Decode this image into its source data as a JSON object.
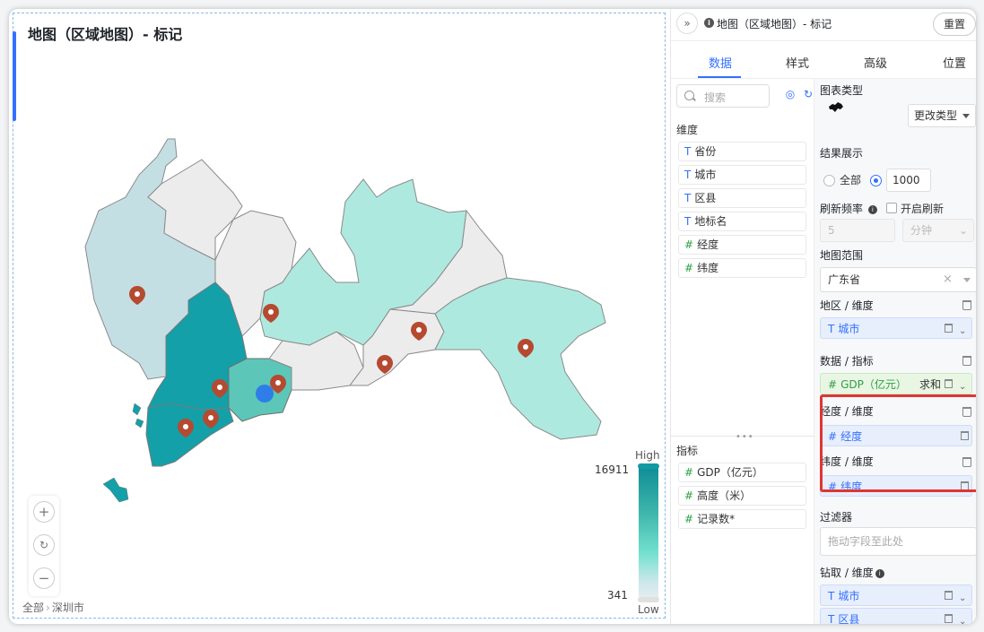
{
  "map": {
    "title": "地图（区域地图）- 标记",
    "legend_high": "High",
    "legend_low": "Low",
    "legend_max": "16911",
    "legend_min": "341",
    "breadcrumb": [
      "全部",
      "深圳市"
    ],
    "zoom_in": "+",
    "zoom_reset": "↻",
    "zoom_out": "−",
    "colors": {
      "dark": "#13a0a8",
      "mid": "#5cc7b9",
      "light": "#aee9df",
      "pale": "#c4dfe4",
      "gray": "#ececec",
      "marker": "#b54a31",
      "point": "#2f7ee8"
    }
  },
  "panel": {
    "title": "地图（区域地图）- 标记",
    "reset": "重置",
    "collapse": "»",
    "info": "i",
    "tabs": [
      "数据",
      "样式",
      "高级",
      "位置"
    ],
    "active_tab": 0,
    "search_placeholder": "搜索",
    "dimension_label": "维度",
    "dimensions": [
      {
        "type": "T",
        "name": "省份"
      },
      {
        "type": "T",
        "name": "城市"
      },
      {
        "type": "T",
        "name": "区县"
      },
      {
        "type": "T",
        "name": "地标名"
      },
      {
        "type": "#",
        "name": "经度"
      },
      {
        "type": "#",
        "name": "纬度"
      }
    ],
    "measure_label": "指标",
    "measures": [
      {
        "type": "#",
        "name": "GDP（亿元）"
      },
      {
        "type": "#",
        "name": "高度（米）"
      },
      {
        "type": "#",
        "name": "记录数*"
      }
    ],
    "splitter": "•••",
    "chart_type_label": "图表类型",
    "change_type": "更改类型",
    "result_label": "结果展示",
    "result_all": "全部",
    "result_count": "1000",
    "refresh_label": "刷新频率",
    "refresh_enable": "开启刷新",
    "refresh_value": "5",
    "refresh_unit": "分钟",
    "map_range_label": "地图范围",
    "map_range_value": "广东省",
    "region_label": "地区 / 维度",
    "region_field": {
      "type": "T",
      "name": "城市"
    },
    "data_label": "数据 / 指标",
    "data_field": {
      "type": "#",
      "name": "GDP（亿元）",
      "agg": "求和"
    },
    "lng_label": "经度 / 维度",
    "lng_field": {
      "type": "#",
      "name": "经度"
    },
    "lat_label": "纬度 / 维度",
    "lat_field": {
      "type": "#",
      "name": "纬度"
    },
    "filter_label": "过滤器",
    "filter_placeholder": "拖动字段至此处",
    "drill_label": "钻取 / 维度",
    "drill_fields": [
      {
        "type": "T",
        "name": "城市"
      },
      {
        "type": "T",
        "name": "区县"
      }
    ]
  }
}
